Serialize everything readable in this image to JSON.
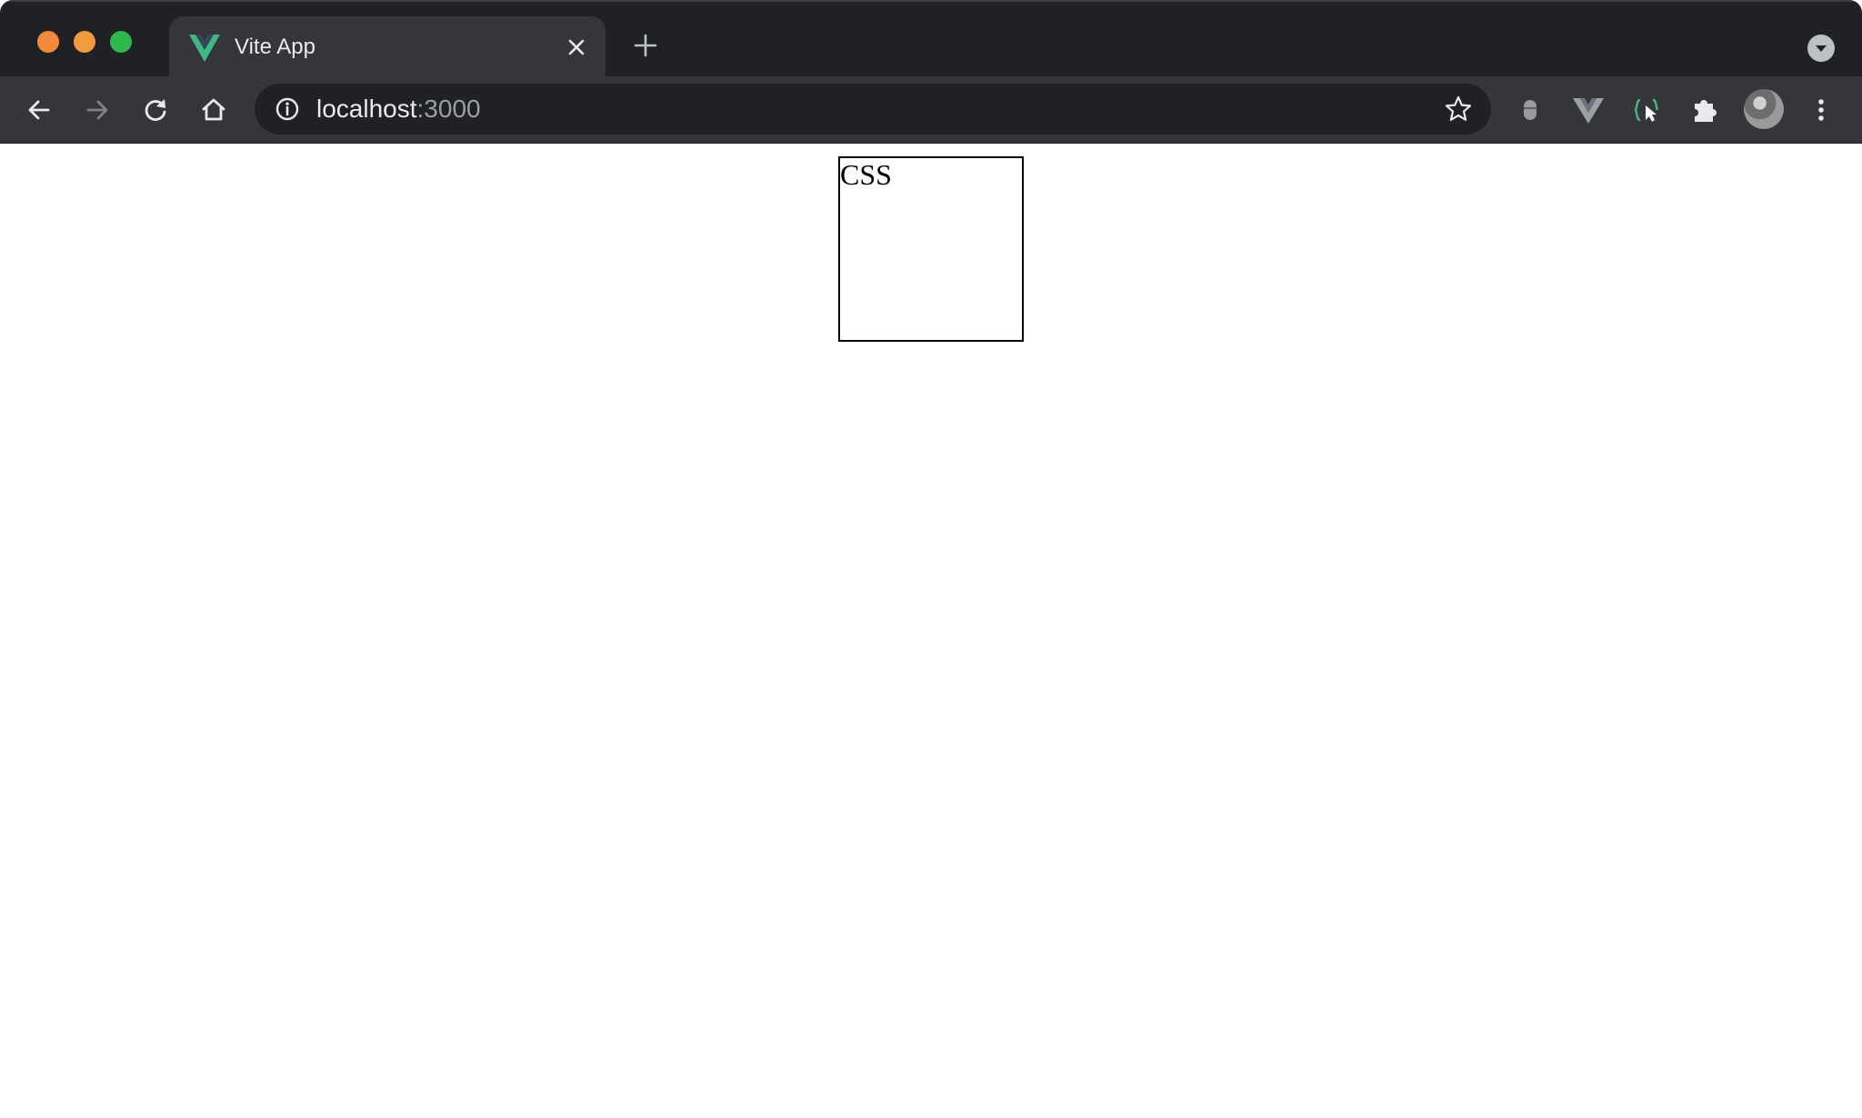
{
  "window": {
    "traffic_lights": {
      "close": "#f28a3c",
      "minimize": "#f29a3c",
      "maximize": "#2fb94d"
    }
  },
  "tab": {
    "title": "Vite App",
    "favicon": "vue-logo-icon",
    "active": true
  },
  "toolbar": {
    "url_host": "localhost",
    "url_port": ":3000",
    "extensions": [
      "extension-icon-gray",
      "vue-devtools-icon",
      "selector-extension-icon",
      "puzzle-extensions-icon"
    ]
  },
  "page": {
    "box_text": "CSS"
  },
  "colors": {
    "tabstrip_bg": "#202124",
    "toolbar_bg": "#35363a",
    "vue_green": "#41b883",
    "vue_dark": "#35495e"
  }
}
